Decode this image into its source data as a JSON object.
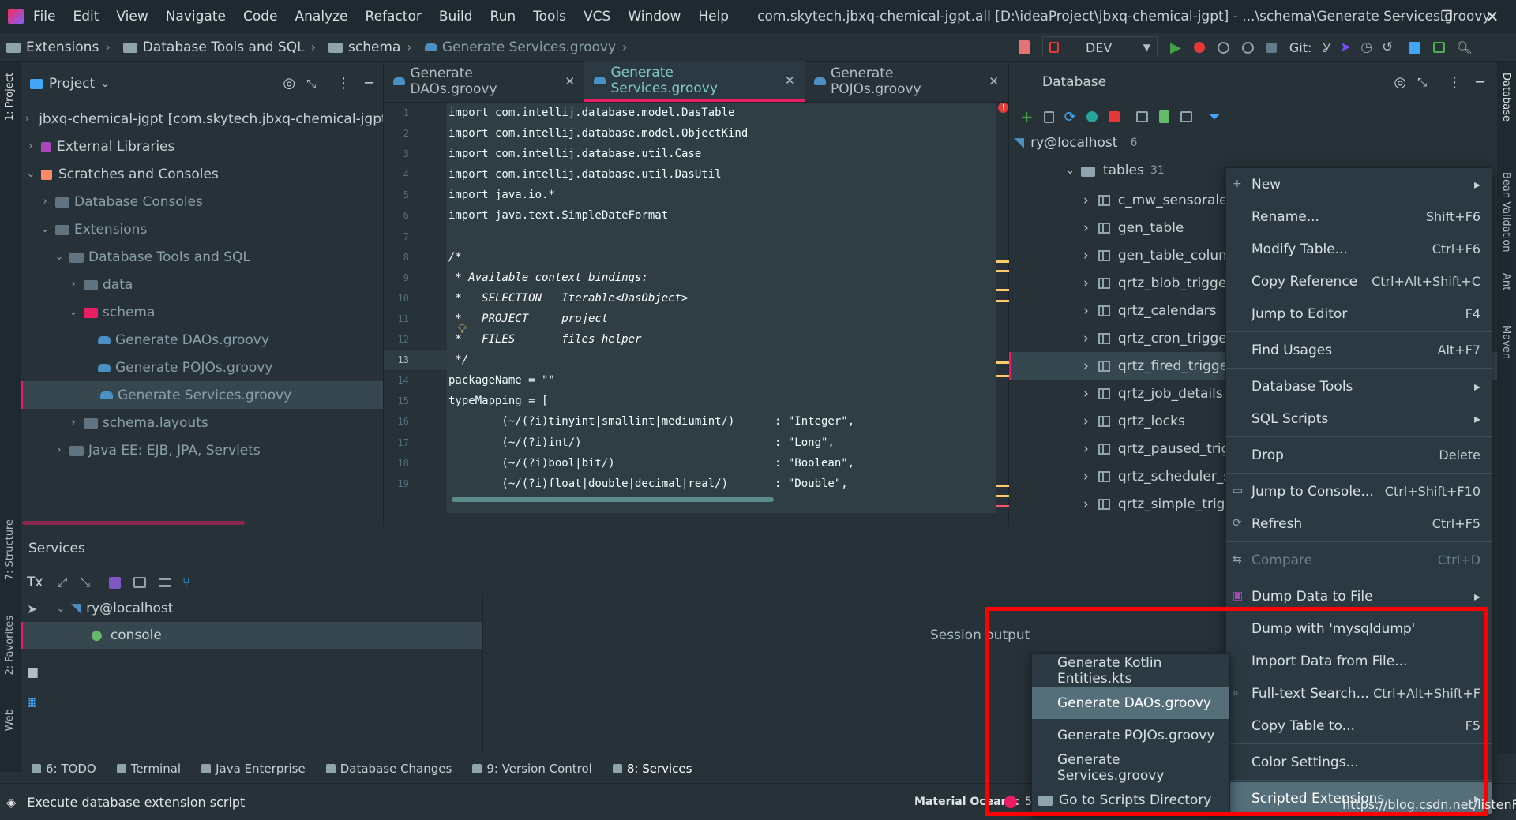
{
  "titlebar": {
    "menu": [
      "File",
      "Edit",
      "View",
      "Navigate",
      "Code",
      "Analyze",
      "Refactor",
      "Build",
      "Run",
      "Tools",
      "VCS",
      "Window",
      "Help"
    ],
    "title": "com.skytech.jbxq-chemical-jgpt.all [D:\\ideaProject\\jbxq-chemical-jgpt] - ...\\schema\\Generate Services.groovy",
    "minimize": "─",
    "restore": "❐",
    "close": "✕"
  },
  "breadcrumb": {
    "items": [
      "Extensions",
      "Database Tools and SQL",
      "schema",
      "Generate Services.groovy"
    ],
    "run_config": "DEV",
    "git_label": "Git:"
  },
  "left_strip": {
    "project": "1: Project",
    "structure": "7: Structure",
    "favorites": "2: Favorites",
    "web": "Web"
  },
  "project": {
    "title": "Project",
    "tree": [
      {
        "label": "jbxq-chemical-jgpt [com.skytech.jbxq-chemical-jgpt.all]",
        "level": 0,
        "arrow": "›",
        "icon": "module"
      },
      {
        "label": "External Libraries",
        "level": 0,
        "arrow": "›",
        "icon": "library"
      },
      {
        "label": "Scratches and Consoles",
        "level": 0,
        "arrow": "⌄",
        "icon": "scratches"
      },
      {
        "label": "Database Consoles",
        "level": 1,
        "arrow": "›",
        "icon": "folder",
        "dim": true
      },
      {
        "label": "Extensions",
        "level": 1,
        "arrow": "⌄",
        "icon": "folder",
        "dim": true
      },
      {
        "label": "Database Tools and SQL",
        "level": 2,
        "arrow": "⌄",
        "icon": "folder-open",
        "dim": true
      },
      {
        "label": "data",
        "level": 3,
        "arrow": "›",
        "icon": "folder",
        "dim": true
      },
      {
        "label": "schema",
        "level": 3,
        "arrow": "⌄",
        "icon": "schema-folder",
        "dim": true
      },
      {
        "label": "Generate DAOs.groovy",
        "level": 4,
        "arrow": "",
        "icon": "groovy",
        "dim": true
      },
      {
        "label": "Generate POJOs.groovy",
        "level": 4,
        "arrow": "",
        "icon": "groovy",
        "dim": true
      },
      {
        "label": "Generate Services.groovy",
        "level": 4,
        "arrow": "",
        "icon": "groovy",
        "dim": true,
        "selected": true
      },
      {
        "label": "schema.layouts",
        "level": 3,
        "arrow": "›",
        "icon": "folder",
        "dim": true
      },
      {
        "label": "Java EE: EJB, JPA, Servlets",
        "level": 2,
        "arrow": "›",
        "icon": "folder",
        "dim": true
      }
    ]
  },
  "editor": {
    "tabs": [
      {
        "label": "Generate DAOs.groovy",
        "close": "✕"
      },
      {
        "label": "Generate Services.groovy",
        "close": "✕",
        "active": true
      },
      {
        "label": "Generate POJOs.groovy",
        "close": "✕"
      }
    ],
    "line_numbers": [
      "1",
      "2",
      "3",
      "4",
      "5",
      "6",
      "7",
      "8",
      "9",
      "10",
      "11",
      "12",
      "13",
      "14",
      "15",
      "16",
      "17",
      "18",
      "19"
    ],
    "lines": [
      {
        "text": "import com.intellij.database.model.DasTable"
      },
      {
        "text": "import com.intellij.database.model.ObjectKind"
      },
      {
        "text": "import com.intellij.database.util.Case"
      },
      {
        "text": "import com.intellij.database.util.DasUtil"
      },
      {
        "text": "import java.io.*"
      },
      {
        "text": "import java.text.SimpleDateFormat"
      },
      {
        "text": ""
      },
      {
        "text": "/*",
        "comment": true
      },
      {
        "text": " * Available context bindings:",
        "comment": true
      },
      {
        "text": " *   SELECTION   Iterable<DasObject>",
        "comment": true
      },
      {
        "text": " *   PROJECT     project",
        "comment": true
      },
      {
        "text": " *   FILES       files helper",
        "comment": true
      },
      {
        "text": " */",
        "comment": true
      },
      {
        "text": "packageName = \"\""
      },
      {
        "text": "typeMapping = ["
      },
      {
        "text": "        (~/(?i)tinyint|smallint|mediumint/)      : \"Integer\","
      },
      {
        "text": "        (~/(?i)int/)                             : \"Long\","
      },
      {
        "text": "        (~/(?i)bool|bit/)                        : \"Boolean\","
      },
      {
        "text": "        (~/(?i)float|double|decimal|real/)       : \"Double\","
      }
    ],
    "current_line": "13",
    "error_indicator": "!"
  },
  "database": {
    "title": "Database",
    "connection": "ry@localhost",
    "connection_count": "6",
    "tables_label": "tables",
    "tables_count": "31",
    "tables": [
      "c_mw_sensoralert",
      "gen_table",
      "gen_table_column",
      "qrtz_blob_triggers",
      "qrtz_calendars",
      "qrtz_cron_triggers",
      "qrtz_fired_triggers",
      "qrtz_job_details",
      "qrtz_locks",
      "qrtz_paused_trigg",
      "qrtz_scheduler_sta",
      "qrtz_simple_trigge"
    ],
    "selected_table": "qrtz_fired_triggers"
  },
  "context_menu": {
    "items": [
      {
        "label": "New",
        "shortcut": "",
        "submenu": true,
        "icon": "plus-icon"
      },
      {
        "label": "Rename...",
        "shortcut": "Shift+F6"
      },
      {
        "label": "Modify Table...",
        "shortcut": "Ctrl+F6"
      },
      {
        "label": "Copy Reference",
        "shortcut": "Ctrl+Alt+Shift+C"
      },
      {
        "label": "Jump to Editor",
        "shortcut": "F4"
      },
      {
        "sep": true
      },
      {
        "label": "Find Usages",
        "shortcut": "Alt+F7"
      },
      {
        "sep": true
      },
      {
        "label": "Database Tools",
        "shortcut": "",
        "submenu": true
      },
      {
        "label": "SQL Scripts",
        "shortcut": "",
        "submenu": true
      },
      {
        "sep": true
      },
      {
        "label": "Drop",
        "shortcut": "Delete"
      },
      {
        "sep": true
      },
      {
        "label": "Jump to Console...",
        "shortcut": "Ctrl+Shift+F10",
        "icon": "console-icon"
      },
      {
        "label": "Refresh",
        "shortcut": "Ctrl+F5",
        "icon": "refresh-icon"
      },
      {
        "sep": true
      },
      {
        "label": "Compare",
        "shortcut": "Ctrl+D",
        "disabled": true,
        "icon": "compare-icon"
      },
      {
        "sep": true
      },
      {
        "label": "Dump Data to File",
        "shortcut": "",
        "submenu": true,
        "icon": "dump-icon"
      },
      {
        "label": "Dump with 'mysqldump'",
        "shortcut": ""
      },
      {
        "label": "Import Data from File...",
        "shortcut": ""
      },
      {
        "label": "Full-text Search...",
        "shortcut": "Ctrl+Alt+Shift+F",
        "icon": "search-icon"
      },
      {
        "label": "Copy Table to...",
        "shortcut": "F5"
      },
      {
        "sep": true
      },
      {
        "label": "Color Settings...",
        "shortcut": ""
      },
      {
        "sep": true
      },
      {
        "label": "Scripted Extensions",
        "shortcut": "",
        "submenu": true,
        "highlighted": true
      }
    ]
  },
  "submenu": {
    "items": [
      {
        "label": "Generate Kotlin Entities.kts"
      },
      {
        "label": "Generate DAOs.groovy",
        "highlighted": true
      },
      {
        "label": "Generate POJOs.groovy"
      },
      {
        "label": "Generate Services.groovy"
      },
      {
        "label": "Go to Scripts Directory",
        "icon": "folder-icon"
      }
    ]
  },
  "services": {
    "title": "Services",
    "tx_label": "Tx",
    "connection": "ry@localhost",
    "console": "console",
    "session_output": "Session output"
  },
  "bottom_tabs": [
    {
      "label": "6: TODO"
    },
    {
      "label": "Terminal"
    },
    {
      "label": "Java Enterprise"
    },
    {
      "label": "Database Changes"
    },
    {
      "label": "9: Version Control"
    },
    {
      "label": "8: Services",
      "active": true
    }
  ],
  "status": {
    "message": "Execute database extension script",
    "theme": "Material Oceanic",
    "theme_extra": "5"
  },
  "right_strip": {
    "database": "Database",
    "bean_validation": "Bean Validation",
    "ant": "Ant",
    "maven": "Maven"
  },
  "watermark": "https://blog.csdn.net/listenFen",
  "colors": {
    "accent": "#e91e63",
    "highlight_box": "#ff0000",
    "background": "#263238"
  }
}
